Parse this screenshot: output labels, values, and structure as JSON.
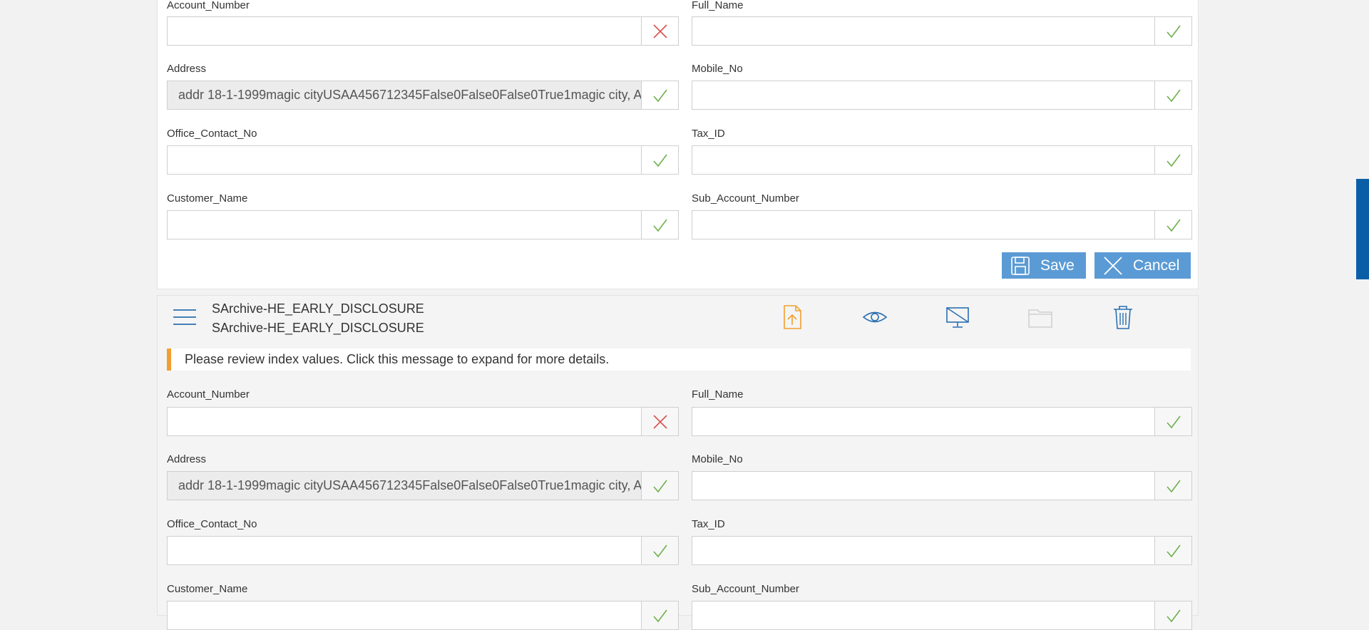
{
  "colors": {
    "accent": "#5b9bd5",
    "ok": "#6cb04a",
    "error": "#d9534f",
    "warning_bar": "#f0a030",
    "side_tab": "#0a5ea8"
  },
  "form1": {
    "fields": {
      "account_number": {
        "label": "Account_Number",
        "value": "",
        "status": "error"
      },
      "full_name": {
        "label": "Full_Name",
        "value": "",
        "status": "ok"
      },
      "address": {
        "label": "Address",
        "value": "addr 18-1-1999magic cityUSAA456712345False0False0False0True1magic city, A",
        "status": "ok"
      },
      "mobile_no": {
        "label": "Mobile_No",
        "value": "",
        "status": "ok"
      },
      "office_contact_no": {
        "label": "Office_Contact_No",
        "value": "",
        "status": "ok"
      },
      "tax_id": {
        "label": "Tax_ID",
        "value": "",
        "status": "ok"
      },
      "customer_name": {
        "label": "Customer_Name",
        "value": "",
        "status": "ok"
      },
      "sub_account_number": {
        "label": "Sub_Account_Number",
        "value": "",
        "status": "ok"
      }
    },
    "save_label": "Save",
    "cancel_label": "Cancel"
  },
  "form2": {
    "title_line1": "SArchive-HE_EARLY_DISCLOSURE",
    "title_line2": "SArchive-HE_EARLY_DISCLOSURE",
    "toolbar_icons": [
      "upload-icon",
      "view-icon",
      "monitor-off-icon",
      "folder-icon",
      "trash-icon"
    ],
    "message": "Please review index values. Click this message to expand for more details.",
    "fields": {
      "account_number": {
        "label": "Account_Number",
        "value": "",
        "status": "error"
      },
      "full_name": {
        "label": "Full_Name",
        "value": "",
        "status": "ok"
      },
      "address": {
        "label": "Address",
        "value": "addr 18-1-1999magic cityUSAA456712345False0False0False0True1magic city, A",
        "status": "ok"
      },
      "mobile_no": {
        "label": "Mobile_No",
        "value": "",
        "status": "ok"
      },
      "office_contact_no": {
        "label": "Office_Contact_No",
        "value": "",
        "status": "ok"
      },
      "tax_id": {
        "label": "Tax_ID",
        "value": "",
        "status": "ok"
      },
      "customer_name": {
        "label": "Customer_Name",
        "value": "",
        "status": "ok"
      },
      "sub_account_number": {
        "label": "Sub_Account_Number",
        "value": "",
        "status": "ok"
      }
    }
  }
}
